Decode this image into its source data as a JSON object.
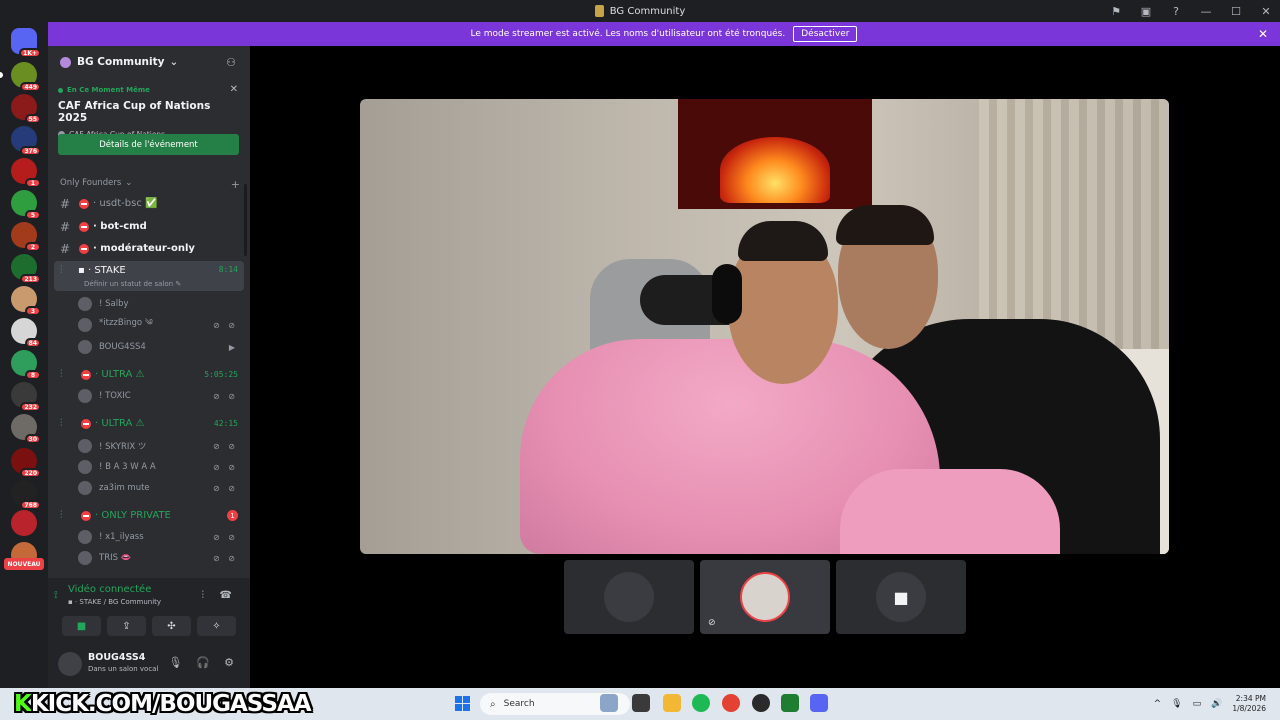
{
  "window": {
    "title": "BG Community",
    "controls": [
      "⚑",
      "▣",
      "?",
      "—",
      "☐",
      "✕"
    ]
  },
  "banner": {
    "text": "Le mode streamer est activé. Les noms d'utilisateur ont été tronqués.",
    "button": "Désactiver",
    "close": "✕"
  },
  "rail": {
    "badges": [
      "1K+",
      "449",
      "55",
      "376",
      "1",
      "5",
      "2",
      "213",
      "3",
      "84",
      "8",
      "232",
      "30",
      "220",
      "768"
    ],
    "new_label": "NOUVEAU"
  },
  "server": {
    "name": "BG Community",
    "chevron": "⌄",
    "add_member_icon": "person-add-icon"
  },
  "event": {
    "live_label": "En Ce Moment Même",
    "title": "CAF Africa Cup of Nations 2025",
    "location": "CAF Africa Cup of Nations",
    "button": "Détails de l'événement"
  },
  "category": {
    "name": "Only Founders",
    "chevron": "⌄",
    "plus": "+"
  },
  "channels": {
    "text": [
      {
        "name": "usdt-bsc",
        "suffix": "✅",
        "unread": false
      },
      {
        "name": "bot-cmd",
        "suffix": "",
        "unread": true
      },
      {
        "name": "modérateur-only",
        "suffix": "",
        "unread": true
      }
    ],
    "voice": [
      {
        "name": "STAKE",
        "time": "8:14",
        "status": "Définir un statut de salon ✎",
        "active": true,
        "users": [
          {
            "name": "! Salby",
            "icons": ""
          },
          {
            "name": "*itzzBingo ༄",
            "icons": "⊘ ⊘"
          },
          {
            "name": "BOUG4SS4",
            "icons": "▶"
          }
        ]
      },
      {
        "name": "ULTRA ⚠",
        "time": "5:05:25",
        "active": false,
        "users": [
          {
            "name": "! TOXIC",
            "icons": "⊘ ⊘"
          }
        ]
      },
      {
        "name": "ULTRA ⚠",
        "time": "42:15",
        "active": false,
        "users": [
          {
            "name": "! SKYRIX ツ",
            "icons": "⊘ ⊘"
          },
          {
            "name": "! B A 3 W A A",
            "icons": "⊘ ⊘"
          },
          {
            "name": "za3im mute",
            "icons": "⊘ ⊘"
          }
        ]
      },
      {
        "name": "ONLY PRIVATE",
        "count": "1",
        "active": false,
        "users": [
          {
            "name": "! x1_ilyass",
            "icons": "⊘ ⊘"
          },
          {
            "name": "TRIS 👄",
            "icons": "⊘ ⊘"
          }
        ]
      }
    ]
  },
  "voice_panel": {
    "status": "Vidéo connectée",
    "location": "STAKE / BG Community",
    "buttons": [
      "■",
      "⇪",
      "✣",
      "✧"
    ]
  },
  "user_panel": {
    "name": "BOUG4SS4",
    "status": "Dans un salon vocal",
    "controls": [
      "🎙",
      "🎧",
      "⚙"
    ]
  },
  "tiles": [
    {
      "name": "participant-1",
      "speaking": false
    },
    {
      "name": "participant-2",
      "speaking": true
    },
    {
      "name": "participant-3",
      "speaking": false
    }
  ],
  "overlay": {
    "kick_k": "K",
    "kick_text": "KICK.COM/BOUGASSAA"
  },
  "taskbar": {
    "search_placeholder": "Search",
    "time": "2:34 PM",
    "date": "1/8/2026",
    "tray_icons": [
      "^",
      "🎙",
      "▭",
      "🔊"
    ]
  },
  "colors": {
    "banner": "#7a36d9",
    "online_green": "#23a55a",
    "kick_green": "#53fc18",
    "danger": "#ed4245"
  }
}
